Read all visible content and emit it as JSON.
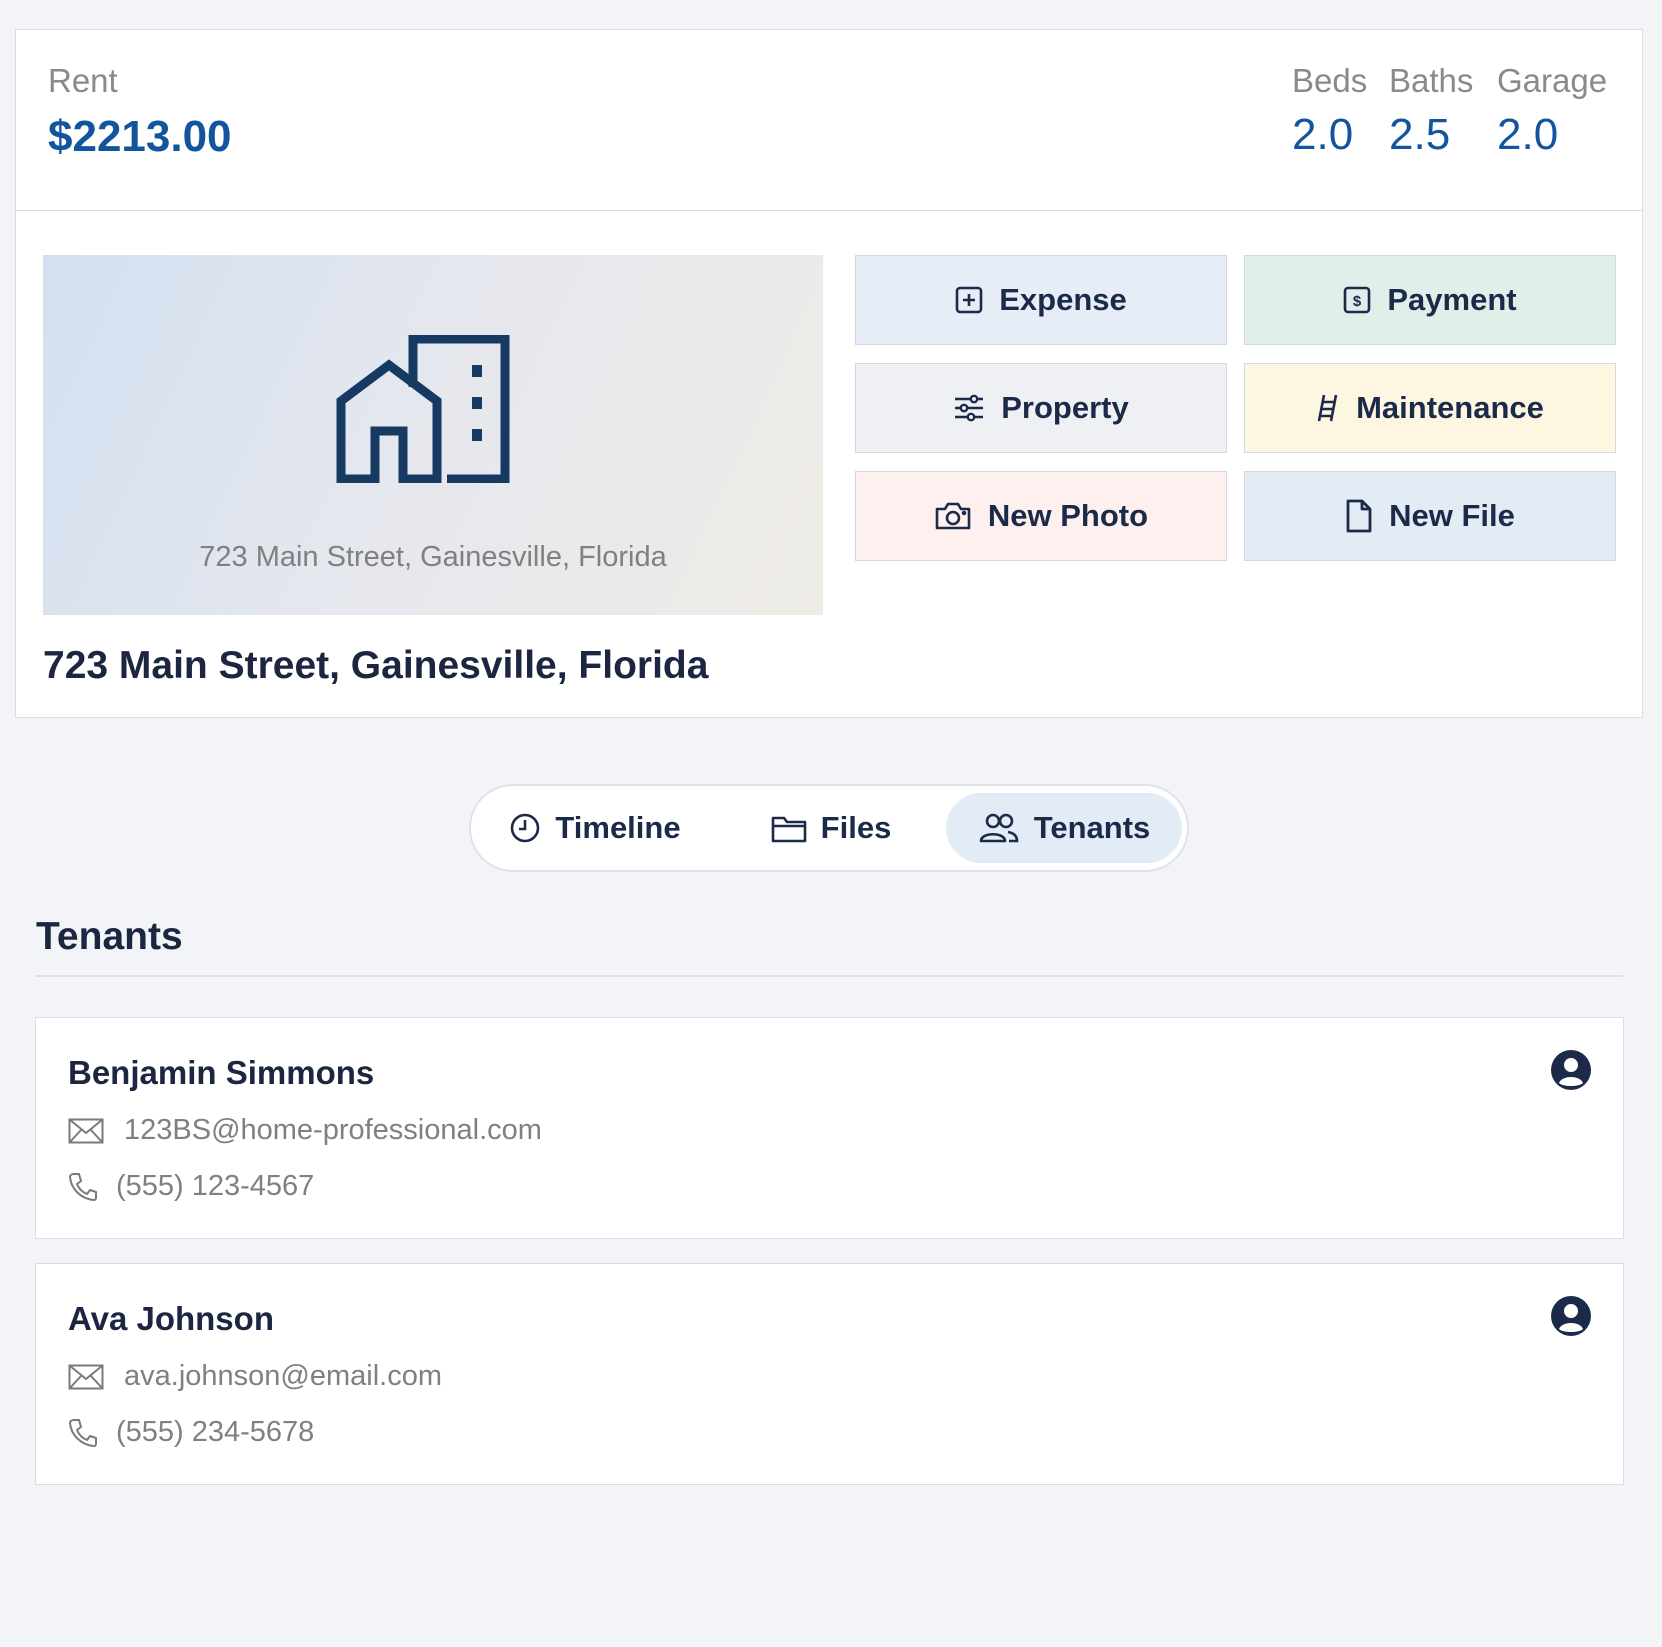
{
  "stats": {
    "rent_label": "Rent",
    "rent_value": "$2213.00",
    "beds_label": "Beds",
    "beds_value": "2.0",
    "baths_label": "Baths",
    "baths_value": "2.5",
    "garage_label": "Garage",
    "garage_value": "2.0"
  },
  "property": {
    "image_caption": "723 Main Street, Gainesville, Florida",
    "address": "723 Main Street, Gainesville, Florida",
    "image_icon": "building-icon"
  },
  "actions": {
    "expense": "Expense",
    "payment": "Payment",
    "property": "Property",
    "maintenance": "Maintenance",
    "new_photo": "New Photo",
    "new_file": "New File"
  },
  "tabs": {
    "timeline": "Timeline",
    "files": "Files",
    "tenants": "Tenants",
    "active": "Tenants"
  },
  "tenants_section": {
    "title": "Tenants",
    "items": [
      {
        "name": "Benjamin Simmons",
        "email": "123BS@home-professional.com",
        "phone": "(555) 123-4567"
      },
      {
        "name": "Ava Johnson",
        "email": "ava.johnson@email.com",
        "phone": "(555) 234-5678"
      }
    ]
  },
  "colors": {
    "accent": "#12559c",
    "expense_bg": "#e7edf7",
    "payment_bg": "#e0efea",
    "property_bg": "#eef0f4",
    "maintenance_bg": "#fdf7e2",
    "new_photo_bg": "#fdf0ee",
    "new_file_bg": "#e3ecf4",
    "active_tab_bg": "#e3ebf6"
  }
}
